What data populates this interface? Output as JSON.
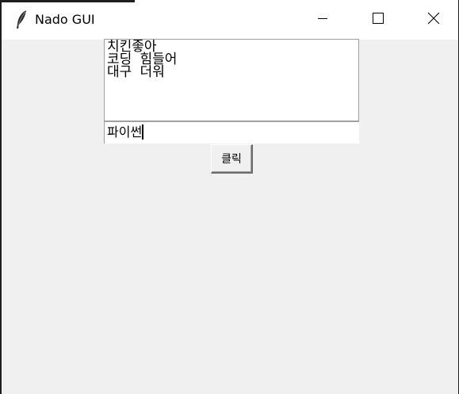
{
  "window": {
    "title": "Nado GUI",
    "icon": "feather-icon"
  },
  "titlebar_controls": {
    "minimize_icon": "minimize-icon",
    "maximize_icon": "maximize-icon",
    "close_icon": "close-icon"
  },
  "text_box": {
    "value": "치킨좋아\n코딩 힘들어\n대구 더워"
  },
  "entry": {
    "value": "파이썬"
  },
  "click_button": {
    "label": "클릭"
  },
  "colors": {
    "window_bg": "#f0f0f0",
    "titlebar_bg": "#ffffff",
    "field_bg": "#ffffff",
    "field_border": "#a0a0a0"
  }
}
